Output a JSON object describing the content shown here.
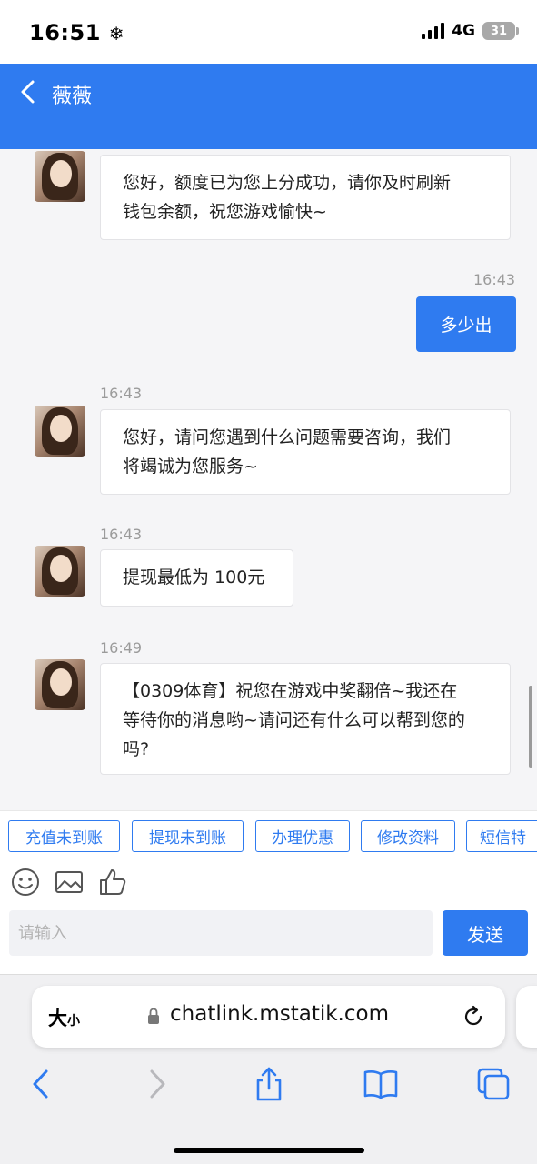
{
  "status_bar": {
    "time": "16:51",
    "time_icon": "snowflake-icon",
    "network": "4G",
    "battery": "31"
  },
  "header": {
    "title": "薇薇",
    "back_icon": "chevron-left-icon"
  },
  "messages": [
    {
      "direction": "in",
      "time": "",
      "lines": [
        "您好，额度已为您上分成功，请你及时刷新",
        "钱包余额，祝您游戏愉快~"
      ]
    },
    {
      "direction": "out",
      "time": "16:43",
      "text": "多少出"
    },
    {
      "direction": "in",
      "time": "16:43",
      "lines": [
        "您好，请问您遇到什么问题需要咨询，我们",
        "将竭诚为您服务~"
      ]
    },
    {
      "direction": "in",
      "time": "16:43",
      "lines": [
        "提现最低为 100元"
      ]
    },
    {
      "direction": "in",
      "time": "16:49",
      "lines": [
        "【0309体育】祝您在游戏中奖翻倍~我还在",
        "等待你的消息哟~请问还有什么可以帮到您的",
        "吗?"
      ]
    }
  ],
  "quick_replies": [
    "充值未到账",
    "提现未到账",
    "办理优惠",
    "修改资料",
    "短信特"
  ],
  "toolbar": {
    "icons": [
      "emoji-icon",
      "image-icon",
      "thumbs-up-icon"
    ]
  },
  "input": {
    "placeholder": "请输入",
    "value": ""
  },
  "send_label": "发送",
  "browser": {
    "text_size_big": "大",
    "text_size_small": "小",
    "url": "chatlink.mstatik.com",
    "nav_icons": [
      "back-icon",
      "forward-icon",
      "share-icon",
      "bookmarks-icon",
      "tabs-icon"
    ]
  },
  "colors": {
    "accent": "#2f7bf0",
    "background": "#f5f5f7",
    "bubble_in": "#ffffff",
    "timestamp": "#9b9b9b"
  }
}
